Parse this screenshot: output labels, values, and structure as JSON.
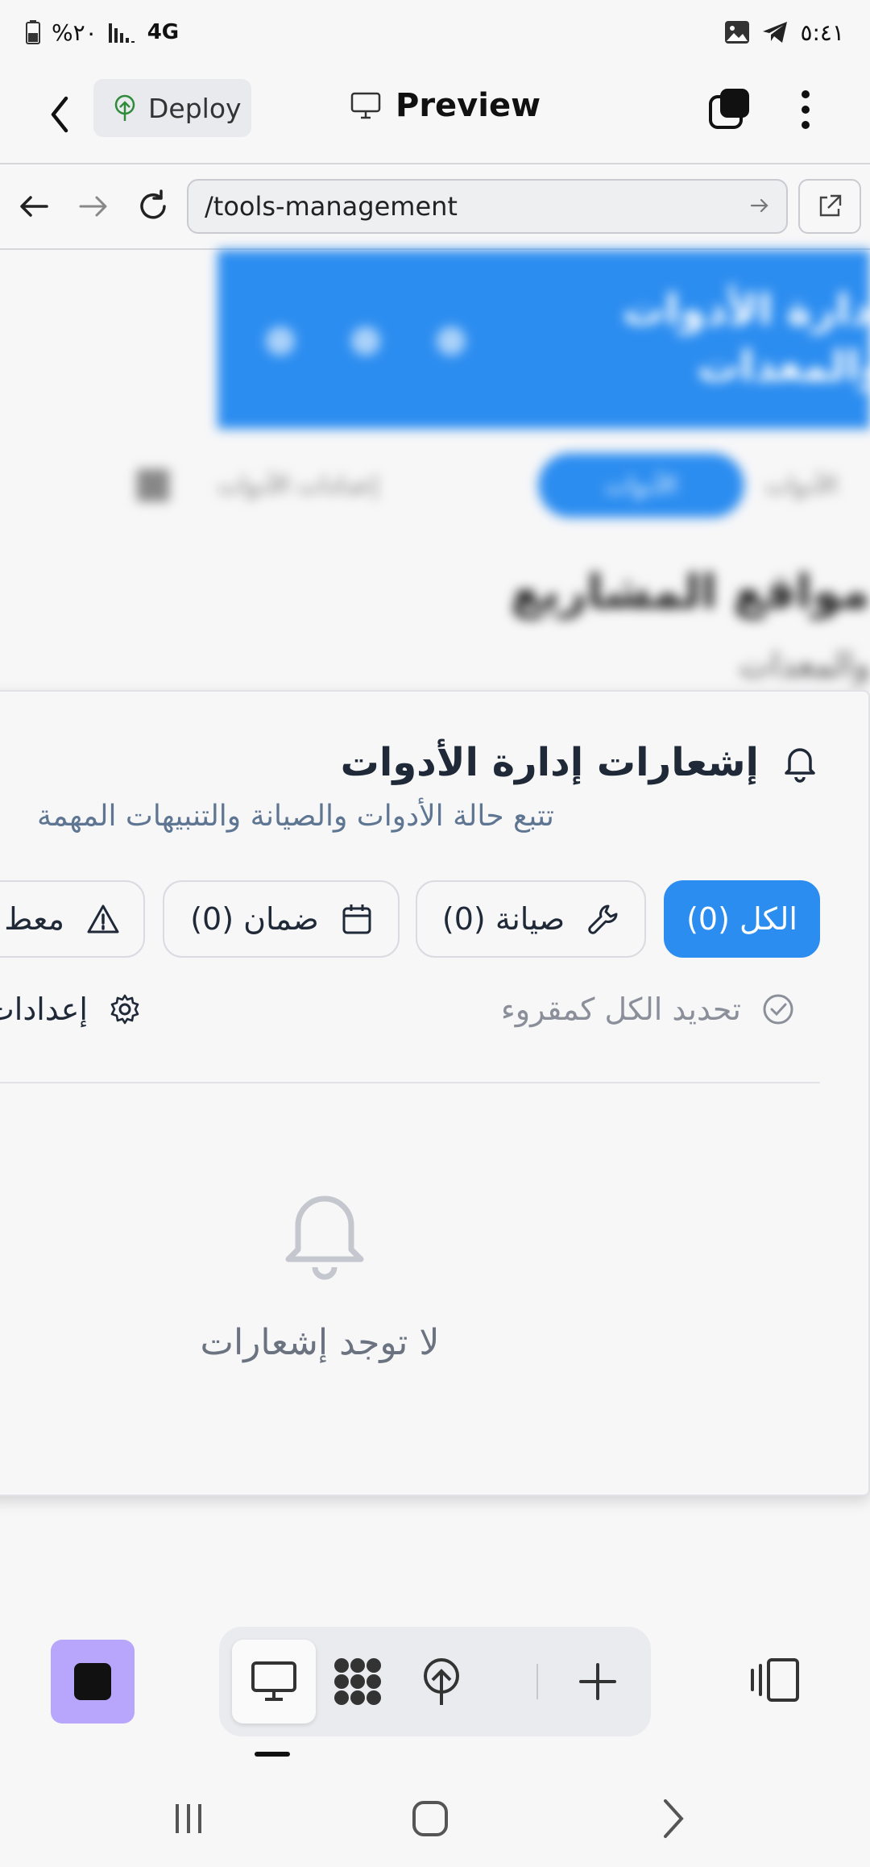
{
  "status_bar": {
    "battery": "٢٠%",
    "network": "4G",
    "time": "٥:٤١"
  },
  "app_bar": {
    "deploy_label": "Deploy",
    "preview_label": "Preview"
  },
  "browser": {
    "url": "/tools-management"
  },
  "background_page": {
    "banner_title": "إدارة الأدوات والمعدات",
    "nav_active": "الأدوات",
    "nav_tools_label": "إعدادات الأدوات",
    "nav_left": "الأدوات",
    "heading": "مواقع المشاريع",
    "subheading": "والمعدات"
  },
  "notifications": {
    "title": "إشعارات إدارة الأدوات",
    "subtitle": "تتبع حالة الأدوات والصيانة والتنبيهات المهمة",
    "filters": [
      {
        "label": "الكل (0)",
        "icon": "none",
        "active": true
      },
      {
        "label": "صيانة (0)",
        "icon": "wrench-icon",
        "active": false
      },
      {
        "label": "ضمان (0)",
        "icon": "calendar-icon",
        "active": false
      },
      {
        "label": "معط",
        "icon": "warning-icon",
        "active": false
      }
    ],
    "mark_all_read": "تحديد الكل كمقروء",
    "settings_label": "إعدادات",
    "empty_text": "لا توجد إشعارات"
  },
  "colors": {
    "accent": "#2c8df0",
    "stop_button": "#b7a6fb",
    "subtitle": "#5f7693"
  }
}
